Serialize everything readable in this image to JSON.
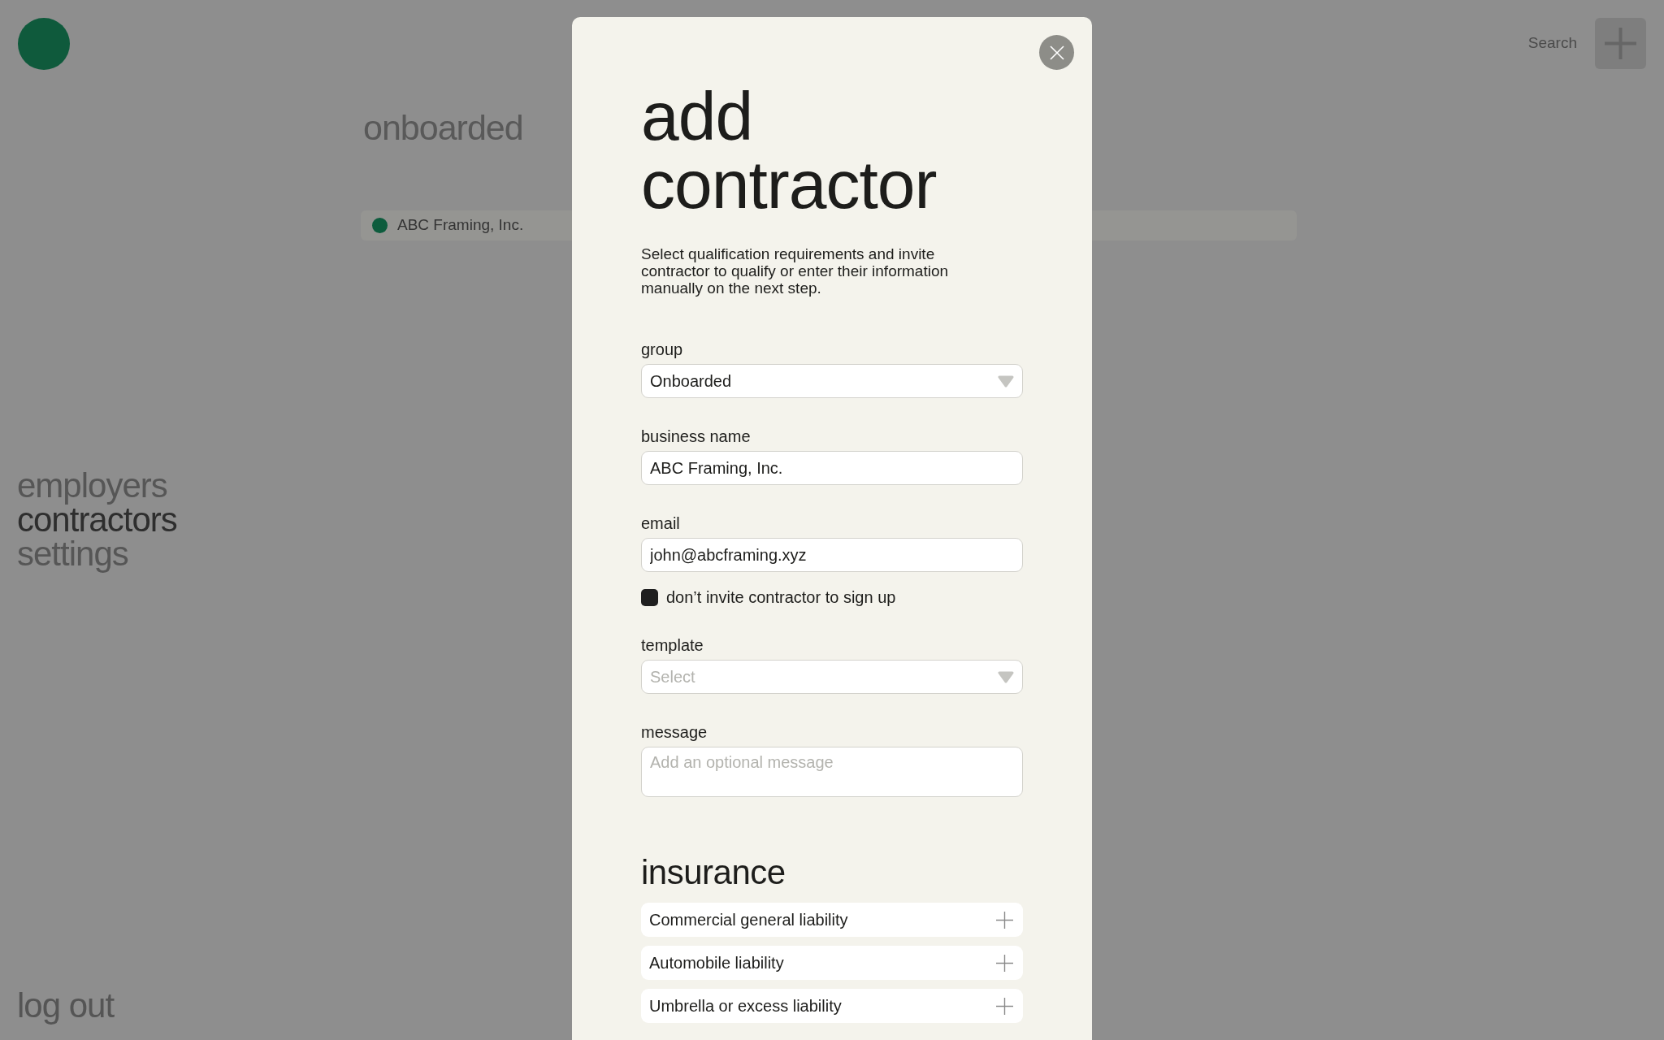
{
  "background": {
    "header": {
      "search": "Search"
    },
    "nav": [
      {
        "label": "employers",
        "selected": false
      },
      {
        "label": "contractors",
        "selected": true
      },
      {
        "label": "settings",
        "selected": false
      }
    ],
    "logout": "log out",
    "page": {
      "title": "onboarded",
      "rows": [
        {
          "name": "ABC Framing, Inc.",
          "color": "#0d5c3d"
        }
      ]
    }
  },
  "dialog": {
    "title": "add contractor",
    "description": "Select qualification requirements and invite contractor to qualify or enter their information manually on the next step.",
    "fields": [
      {
        "kind": "select",
        "label": "group",
        "value": "Onboarded"
      },
      {
        "kind": "text",
        "label": "business name",
        "value": "ABC Framing, Inc."
      },
      {
        "kind": "text",
        "label": "email",
        "value": "john@abcframing.xyz"
      },
      {
        "kind": "checkbox",
        "label": "don’t invite contractor to sign up",
        "checked": true
      },
      {
        "kind": "select",
        "label": "template",
        "placeholder": "Select"
      },
      {
        "kind": "textarea",
        "label": "message",
        "placeholder": "Add an optional message"
      }
    ],
    "insurance": {
      "title": "insurance",
      "items": [
        {
          "label": "Commercial general liability",
          "expanded": false
        },
        {
          "label": "Automobile liability",
          "expanded": false
        },
        {
          "label": "Umbrella or excess liability",
          "expanded": false
        }
      ]
    }
  }
}
